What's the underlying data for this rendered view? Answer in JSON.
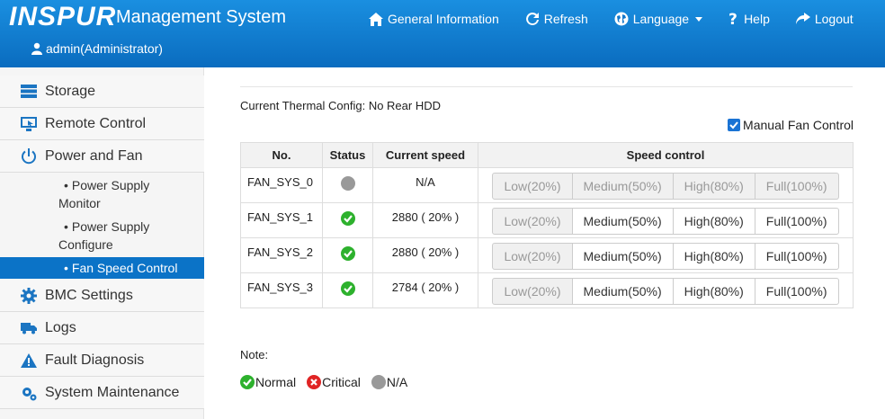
{
  "header": {
    "logo": "INSPUR",
    "title": "Management System",
    "user": "admin(Administrator)",
    "nav": [
      {
        "label": "General Information",
        "icon": "home-icon"
      },
      {
        "label": "Refresh",
        "icon": "refresh-icon"
      },
      {
        "label": "Language",
        "icon": "globe-icon"
      },
      {
        "label": "Help",
        "icon": "question-icon"
      },
      {
        "label": "Logout",
        "icon": "logout-icon"
      }
    ]
  },
  "sidebar": {
    "items": [
      {
        "label": "Storage",
        "icon": "storage-icon"
      },
      {
        "label": "Remote Control",
        "icon": "monitor-icon"
      },
      {
        "label": "Power and Fan",
        "icon": "power-icon"
      },
      {
        "label": "BMC Settings",
        "icon": "gear-icon"
      },
      {
        "label": "Logs",
        "icon": "truck-icon"
      },
      {
        "label": "Fault Diagnosis",
        "icon": "warning-icon"
      },
      {
        "label": "System Maintenance",
        "icon": "gears-icon"
      }
    ],
    "subitems": [
      {
        "line1": "Power Supply",
        "line2": "Monitor"
      },
      {
        "line1": "Power Supply",
        "line2": "Configure"
      },
      {
        "line1": "Fan Speed Control",
        "line2": ""
      }
    ]
  },
  "content": {
    "thermal_label": "Current Thermal Config: No Rear HDD",
    "manual_label": "Manual Fan Control",
    "manual_checked": true,
    "columns": [
      "No.",
      "Status",
      "Current speed",
      "Speed control"
    ],
    "speed_options": [
      "Low(20%)",
      "Medium(50%)",
      "High(80%)",
      "Full(100%)"
    ],
    "fans": [
      {
        "name": "FAN_SYS_0",
        "status": "na",
        "speed": "N/A"
      },
      {
        "name": "FAN_SYS_1",
        "status": "ok",
        "speed": "2880 ( 20% )"
      },
      {
        "name": "FAN_SYS_2",
        "status": "ok",
        "speed": "2880 ( 20% )"
      },
      {
        "name": "FAN_SYS_3",
        "status": "ok",
        "speed": "2784 ( 20% )"
      }
    ],
    "note": "Note:",
    "legend": [
      {
        "label": "Normal",
        "color": "#2db12d"
      },
      {
        "label": "Critical",
        "color": "#e02424"
      },
      {
        "label": "N/A",
        "color": "#999999"
      }
    ]
  }
}
